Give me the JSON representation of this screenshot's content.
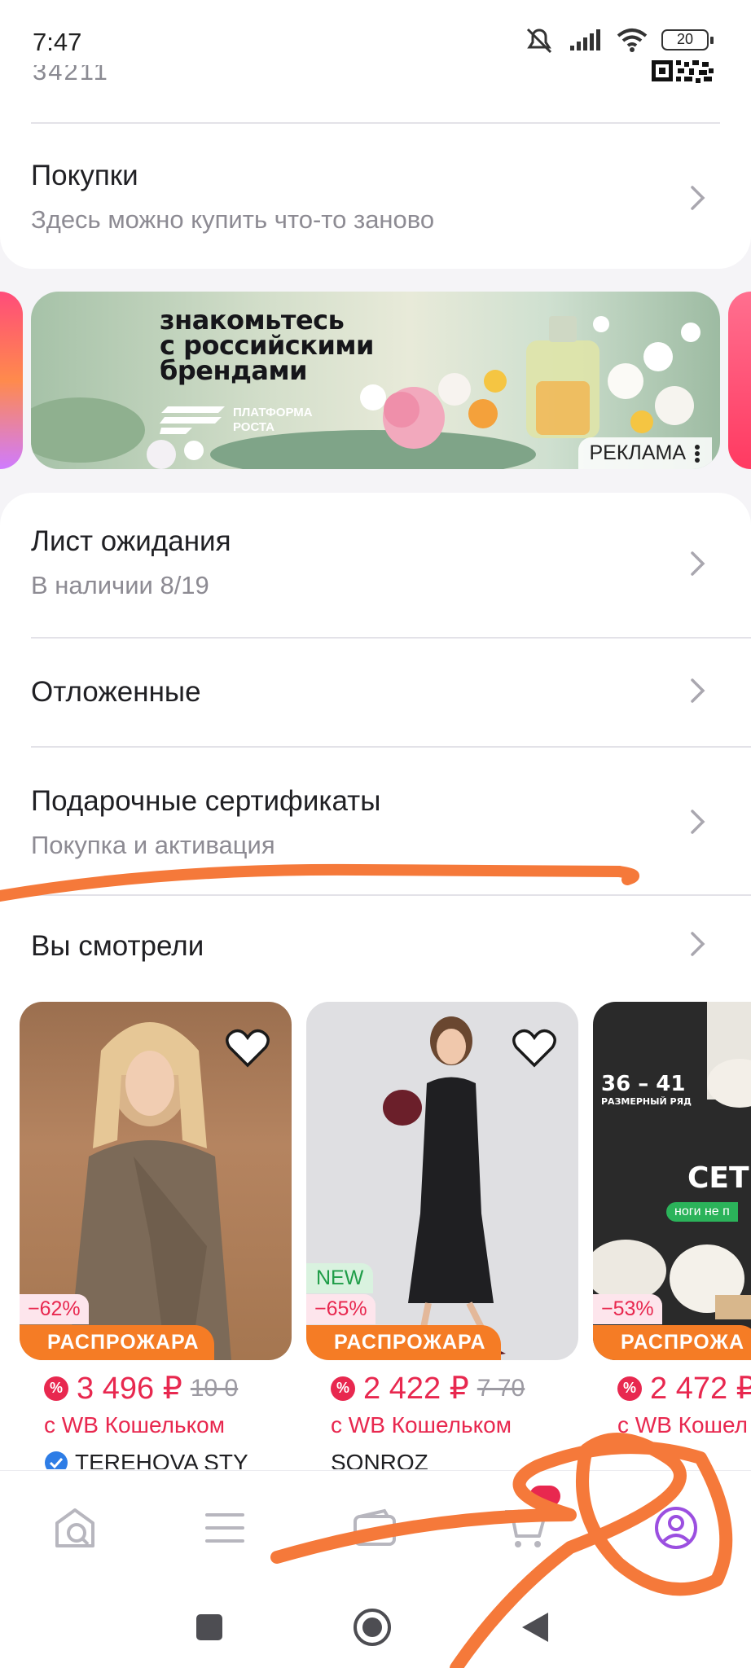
{
  "status_bar": {
    "time": "7:47",
    "battery": "20"
  },
  "header": {
    "cut_text": "34211"
  },
  "purchases": {
    "title": "Покупки",
    "subtitle": "Здесь можно купить что-то заново"
  },
  "banner": {
    "headline_1": "знакомьтесь",
    "headline_2": "с российскими",
    "headline_3": "брендами",
    "platform": "ПЛАТФОРМА РОСТА",
    "ad_label": "РЕКЛАМА"
  },
  "menu": {
    "waitlist_title": "Лист ожидания",
    "waitlist_sub": "В наличии 8/19",
    "deferred_title": "Отложенные",
    "gift_title": "Подарочные сертификаты",
    "gift_sub": "Покупка и активация",
    "viewed_title": "Вы смотрели"
  },
  "products": [
    {
      "discount": "−62%",
      "sale": "РАСПРОЖАРА",
      "price": "3 496 ₽",
      "old_price": "10 0",
      "wallet": "с WB Кошельком",
      "brand": "TEREHOVA STY"
    },
    {
      "new": "NEW",
      "discount": "−65%",
      "sale": "РАСПРОЖАРА",
      "price": "2 422 ₽",
      "old_price": "7 70",
      "wallet": "с WB Кошельком",
      "brand": "SONROZ"
    },
    {
      "size_range": "36 – 41",
      "size_caption": "РАЗМЕРНЫЙ РЯД",
      "promo": "СЕТ",
      "promo_sub": "ноги не п",
      "discount": "−53%",
      "sale": "РАСПРОЖА",
      "price": "2 472 ₽",
      "wallet": "с WB Кошел",
      "brand": ""
    }
  ],
  "colors": {
    "accent": "#e8284f",
    "sale": "#f57c25",
    "profile": "#9b4fe0",
    "annotation": "#f5793a"
  }
}
